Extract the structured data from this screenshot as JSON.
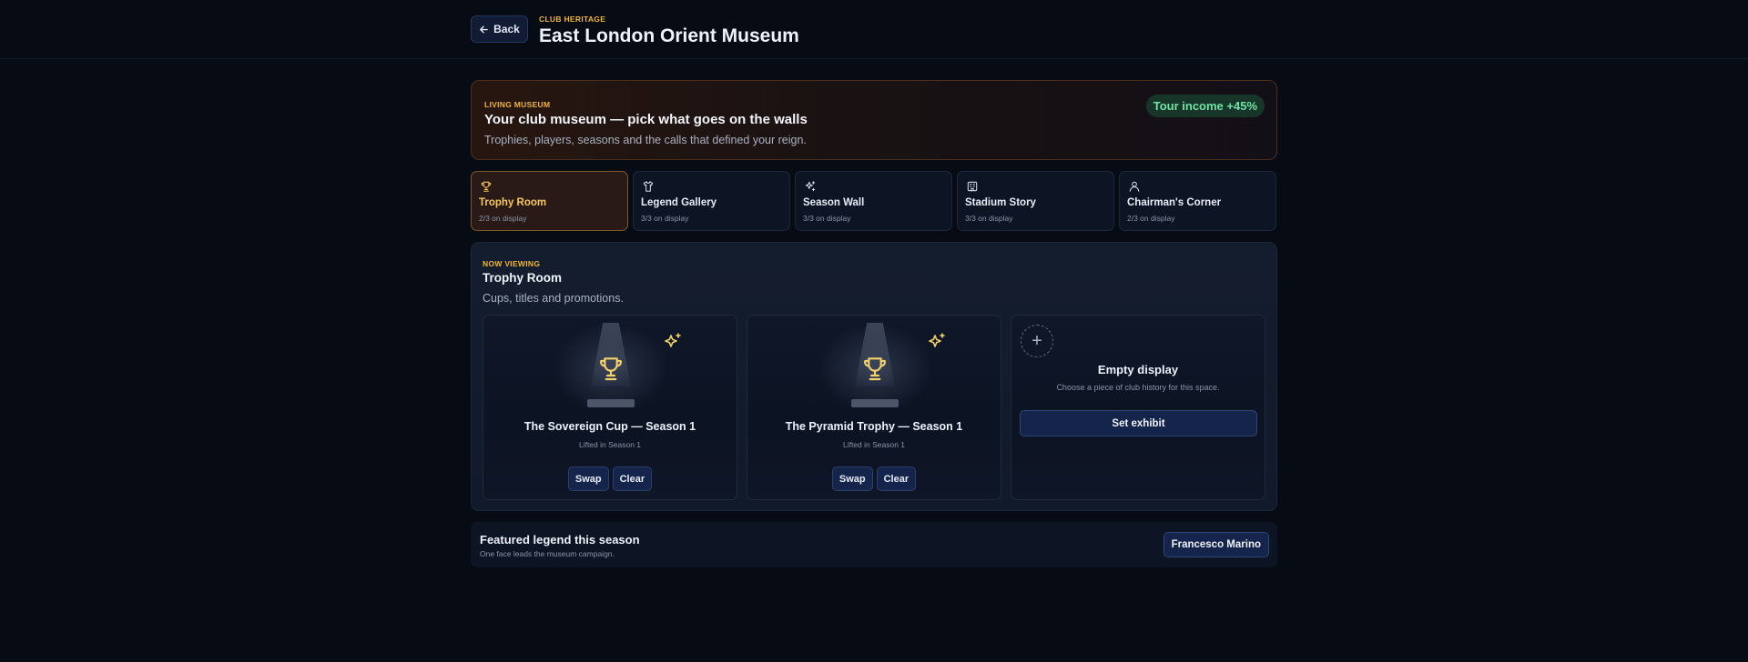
{
  "header": {
    "back_label": "Back",
    "kicker": "CLUB HERITAGE",
    "title": "East London Orient Museum"
  },
  "hero": {
    "kicker": "LIVING MUSEUM",
    "title": "Your club museum — pick what goes on the walls",
    "subtitle": "Trophies, players, seasons and the calls that defined your reign.",
    "income_badge": "Tour income +45%"
  },
  "tabs": [
    {
      "label": "Trophy Room",
      "count": "2/3 on display",
      "icon": "trophy-icon",
      "active": true
    },
    {
      "label": "Legend Gallery",
      "count": "3/3 on display",
      "icon": "shirt-icon",
      "active": false
    },
    {
      "label": "Season Wall",
      "count": "3/3 on display",
      "icon": "sparkles-icon",
      "active": false
    },
    {
      "label": "Stadium Story",
      "count": "3/3 on display",
      "icon": "stadium-icon",
      "active": false
    },
    {
      "label": "Chairman's Corner",
      "count": "2/3 on display",
      "icon": "user-icon",
      "active": false
    }
  ],
  "viewing": {
    "kicker": "NOW VIEWING",
    "title": "Trophy Room",
    "subtitle": "Cups, titles and promotions.",
    "exhibits": [
      {
        "title": "The Sovereign Cup — Season 1",
        "subtitle": "Lifted in Season 1",
        "swap_label": "Swap",
        "clear_label": "Clear"
      },
      {
        "title": "The Pyramid Trophy — Season 1",
        "subtitle": "Lifted in Season 1",
        "swap_label": "Swap",
        "clear_label": "Clear"
      }
    ],
    "empty": {
      "plus": "+",
      "title": "Empty display",
      "subtitle": "Choose a piece of club history for this space.",
      "button_label": "Set exhibit"
    }
  },
  "featured": {
    "title": "Featured legend this season",
    "subtitle": "One face leads the museum campaign.",
    "button_label": "Francesco Marino"
  },
  "colors": {
    "accent_gold": "#f2b630",
    "income_green": "#6fe3a4",
    "background": "#070b14"
  }
}
